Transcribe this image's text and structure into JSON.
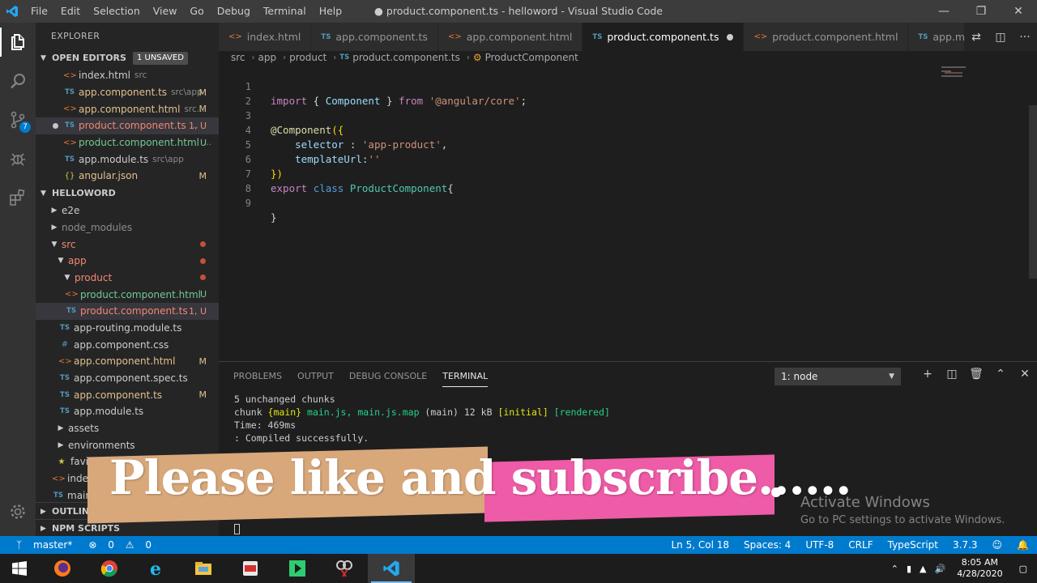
{
  "titlebar": {
    "menu": [
      "File",
      "Edit",
      "Selection",
      "View",
      "Go",
      "Debug",
      "Terminal",
      "Help"
    ],
    "title": "● product.component.ts - helloword - Visual Studio Code"
  },
  "sidebar": {
    "header": "EXPLORER",
    "open_editors_label": "OPEN EDITORS",
    "unsaved_badge": "1 UNSAVED",
    "open_editors": [
      {
        "name": "index.html",
        "desc": "src",
        "status": "",
        "icon": "html"
      },
      {
        "name": "app.component.ts",
        "desc": "src\\app",
        "status": "M",
        "icon": "ts"
      },
      {
        "name": "app.component.html",
        "desc": "src...",
        "status": "M",
        "icon": "html"
      },
      {
        "name": "product.component.ts",
        "desc": "...",
        "status": "1, U",
        "icon": "ts"
      },
      {
        "name": "product.component.html",
        "desc": "...",
        "status": "U",
        "icon": "html"
      },
      {
        "name": "app.module.ts",
        "desc": "src\\app",
        "status": "",
        "icon": "ts"
      },
      {
        "name": "angular.json",
        "desc": "",
        "status": "M",
        "icon": "json"
      }
    ],
    "project_label": "HELLOWORD",
    "tree": [
      {
        "name": "e2e",
        "type": "folder-closed"
      },
      {
        "name": "node_modules",
        "type": "folder-closed"
      },
      {
        "name": "src",
        "type": "folder-open"
      },
      {
        "name": "app",
        "type": "folder-open"
      },
      {
        "name": "product",
        "type": "folder-open"
      },
      {
        "name": "product.component.html",
        "status": "U"
      },
      {
        "name": "product.component.ts",
        "status": "1, U"
      },
      {
        "name": "app-routing.module.ts",
        "status": ""
      },
      {
        "name": "app.component.css",
        "status": ""
      },
      {
        "name": "app.component.html",
        "status": "M"
      },
      {
        "name": "app.component.spec.ts",
        "status": ""
      },
      {
        "name": "app.component.ts",
        "status": "M"
      },
      {
        "name": "app.module.ts",
        "status": ""
      },
      {
        "name": "assets",
        "type": "folder-closed"
      },
      {
        "name": "environments",
        "type": "folder-closed"
      },
      {
        "name": "favicon"
      },
      {
        "name": "index."
      },
      {
        "name": "main."
      }
    ],
    "outline_label": "OUTLINE",
    "npm_label": "NPM SCRIPTS"
  },
  "tabs": [
    {
      "label": "index.html",
      "icon": "html"
    },
    {
      "label": "app.component.ts",
      "icon": "ts"
    },
    {
      "label": "app.component.html",
      "icon": "html"
    },
    {
      "label": "product.component.ts",
      "icon": "ts"
    },
    {
      "label": "product.component.html",
      "icon": "html"
    },
    {
      "label": "app.module.ts",
      "icon": "ts"
    }
  ],
  "breadcrumb": [
    "src",
    "app",
    "product",
    "product.component.ts",
    "ProductComponent"
  ],
  "code_lines": [
    "1",
    "2",
    "3",
    "4",
    "5",
    "6",
    "7",
    "8",
    "9"
  ],
  "code": {
    "l1": {
      "kw": "import",
      "p1": " { ",
      "ty": "Component",
      "p2": " } ",
      "from": "from",
      "str": "'@angular/core'",
      "end": ";"
    },
    "l3": {
      "at": "@Component",
      "p": "({"
    },
    "l4": {
      "prop": "selector",
      "p": " : ",
      "str": "'app-product'",
      "end": ","
    },
    "l5": {
      "prop": "templateUrl",
      "p": ":",
      "str": "''"
    },
    "l6": {
      "p": "})"
    },
    "l7": {
      "kw1": "export",
      "kw2": "class",
      "name": "ProductComponent",
      "p": "{"
    },
    "l9": {
      "p": "}"
    }
  },
  "panel": {
    "tabs": [
      "PROBLEMS",
      "OUTPUT",
      "DEBUG CONSOLE",
      "TERMINAL"
    ],
    "terminal_select": "1: node",
    "terminal": {
      "t1": "5 unchanged chunks",
      "t2a": "chunk ",
      "t2b": "{main}",
      "t2c": " main.js, main.js.map",
      "t2d": " (main) 12 kB ",
      "t2e": "[initial]",
      "t2f": " [rendered]",
      "t3": "Time: 469ms",
      "t4": ": Compiled successfully."
    }
  },
  "overlay": {
    "text": "Please like and subscribe......"
  },
  "activate": {
    "line1": "Activate Windows",
    "line2": "Go to PC settings to activate Windows."
  },
  "statusbar": {
    "branch": "master*",
    "problems": "0",
    "warnings": "0",
    "position": "Ln 5, Col 18",
    "spaces": "Spaces: 4",
    "encoding": "UTF-8",
    "eol": "CRLF",
    "language": "TypeScript",
    "version": "3.7.3"
  },
  "taskbar": {
    "time": "8:05 AM",
    "date": "4/28/2020"
  },
  "colors": {
    "accent": "#007acc",
    "titlebar": "#3c3c3c",
    "banner_pink": "#ee5ba6",
    "banner_tan": "#d8a87a"
  }
}
